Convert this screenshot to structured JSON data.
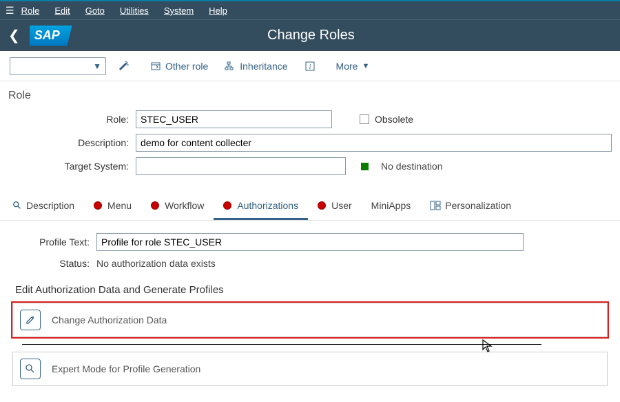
{
  "menu": {
    "items": [
      "Role",
      "Edit",
      "Goto",
      "Utilities",
      "System",
      "Help"
    ]
  },
  "header": {
    "logo": "SAP",
    "title": "Change Roles"
  },
  "toolbar": {
    "other_role": "Other role",
    "inheritance": "Inheritance",
    "more": "More"
  },
  "section": {
    "role_label": "Role"
  },
  "form": {
    "role_lbl": "Role:",
    "role_val": "STEC_USER",
    "obsolete_lbl": "Obsolete",
    "desc_lbl": "Description:",
    "desc_val": "demo for content collecter",
    "target_lbl": "Target System:",
    "target_val": "",
    "no_dest": "No destination"
  },
  "tabs": {
    "description": "Description",
    "menu": "Menu",
    "workflow": "Workflow",
    "authorizations": "Authorizations",
    "user": "User",
    "miniapps": "MiniApps",
    "personalization": "Personalization"
  },
  "detail": {
    "profile_text_lbl": "Profile Text:",
    "profile_text_val": "Profile for role STEC_USER",
    "status_lbl": "Status:",
    "status_val": "No authorization data exists",
    "subhead": "Edit Authorization Data and Generate Profiles",
    "change_auth": "Change Authorization Data",
    "expert_mode": "Expert Mode for Profile Generation"
  }
}
